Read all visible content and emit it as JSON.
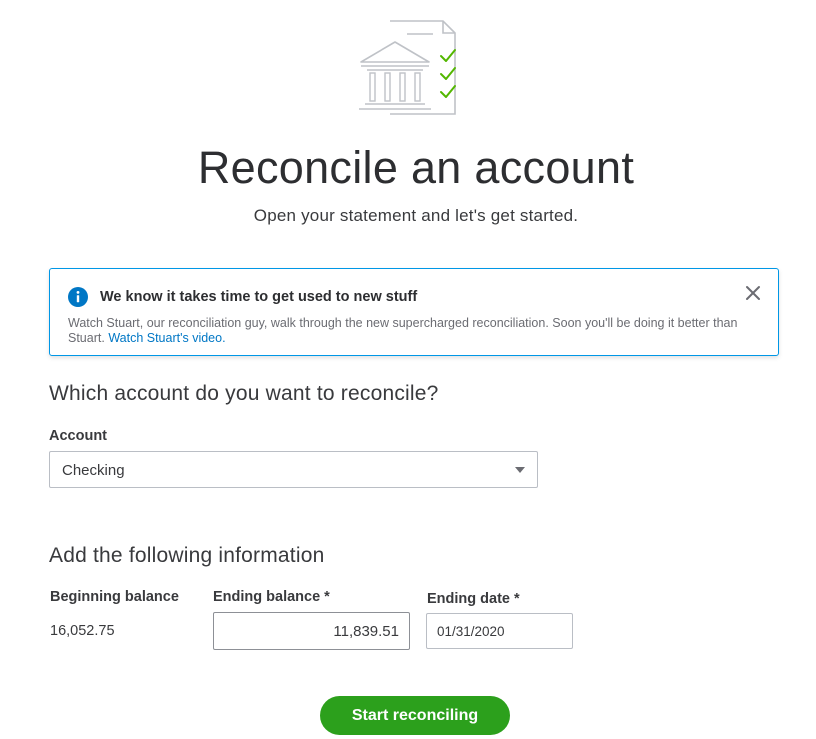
{
  "header": {
    "title": "Reconcile an account",
    "subtitle": "Open your statement and let's get started."
  },
  "info_banner": {
    "title": "We know it takes time to get used to new stuff",
    "body": "Watch Stuart, our reconciliation guy, walk through the new supercharged reconciliation. Soon you'll be doing it better than Stuart.",
    "link_text": "Watch Stuart's video.",
    "icon": "info-icon",
    "close_icon": "close-icon"
  },
  "account_section": {
    "heading": "Which account do you want to reconcile?",
    "account_label": "Account",
    "account_selected": "Checking"
  },
  "info_section": {
    "heading": "Add the following information",
    "beginning_balance_label": "Beginning balance",
    "beginning_balance_value": "16,052.75",
    "ending_balance_label": "Ending balance *",
    "ending_balance_value": "11,839.51",
    "ending_date_label": "Ending date *",
    "ending_date_value": "01/31/2020"
  },
  "actions": {
    "start_label": "Start reconciling"
  },
  "colors": {
    "accent_green": "#2ca01c",
    "check_green": "#53b700",
    "info_blue": "#0077c5",
    "banner_border": "#0097e6"
  }
}
